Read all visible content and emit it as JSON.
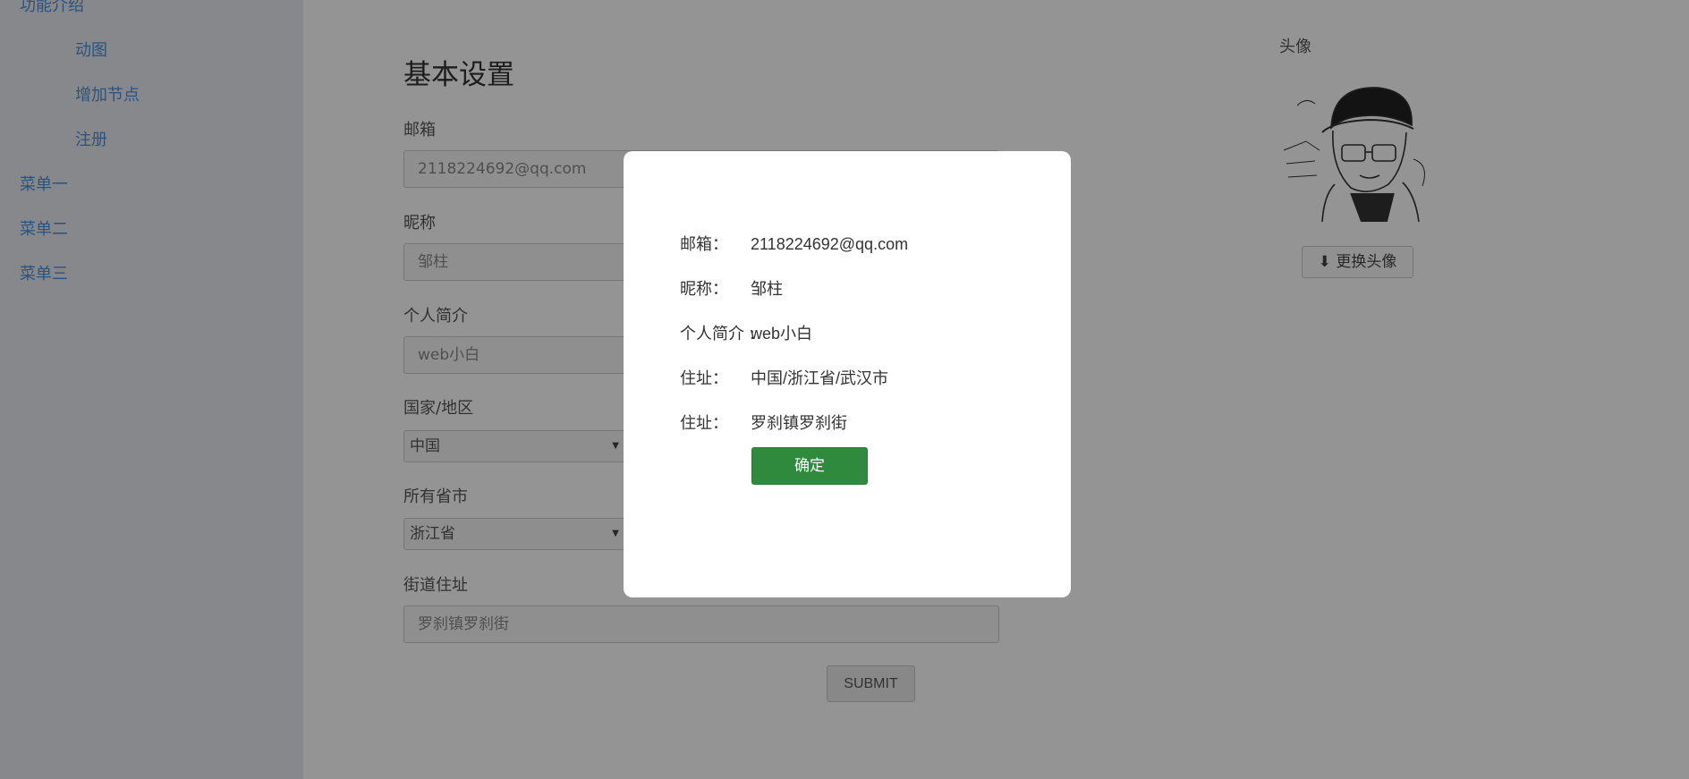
{
  "sidebar": {
    "items": [
      {
        "label": "功能介绍"
      },
      {
        "label": "动图"
      },
      {
        "label": "增加节点"
      },
      {
        "label": "注册"
      },
      {
        "label": "菜单一"
      },
      {
        "label": "菜单二"
      },
      {
        "label": "菜单三"
      }
    ]
  },
  "form": {
    "title": "基本设置",
    "email_label": "邮箱",
    "email_value": "2118224692@qq.com",
    "nickname_label": "昵称",
    "nickname_value": "邹柱",
    "bio_label": "个人简介",
    "bio_value": "web小白",
    "country_label": "国家/地区",
    "country_value": "中国",
    "province_label": "所有省市",
    "province_value": "浙江省",
    "street_label": "街道住址",
    "street_value": "罗刹镇罗刹街",
    "submit_label": "SUBMIT"
  },
  "avatar": {
    "label": "头像",
    "change_label": "更换头像",
    "icon": "download-icon"
  },
  "dialog": {
    "rows": [
      {
        "label": "邮箱：",
        "value": "2118224692@qq.com"
      },
      {
        "label": "昵称：",
        "value": "邹柱"
      },
      {
        "label": "个人简介 :",
        "value": "web小白"
      },
      {
        "label": "住址：",
        "value": "中国/浙江省/武汉市"
      },
      {
        "label": "住址：",
        "value": "罗刹镇罗刹街"
      }
    ],
    "confirm_label": "确定"
  },
  "colors": {
    "confirm_button": "#2f8a3e",
    "sidebar_link": "#4a90d9",
    "overlay": "rgba(0,0,0,0.42)"
  }
}
